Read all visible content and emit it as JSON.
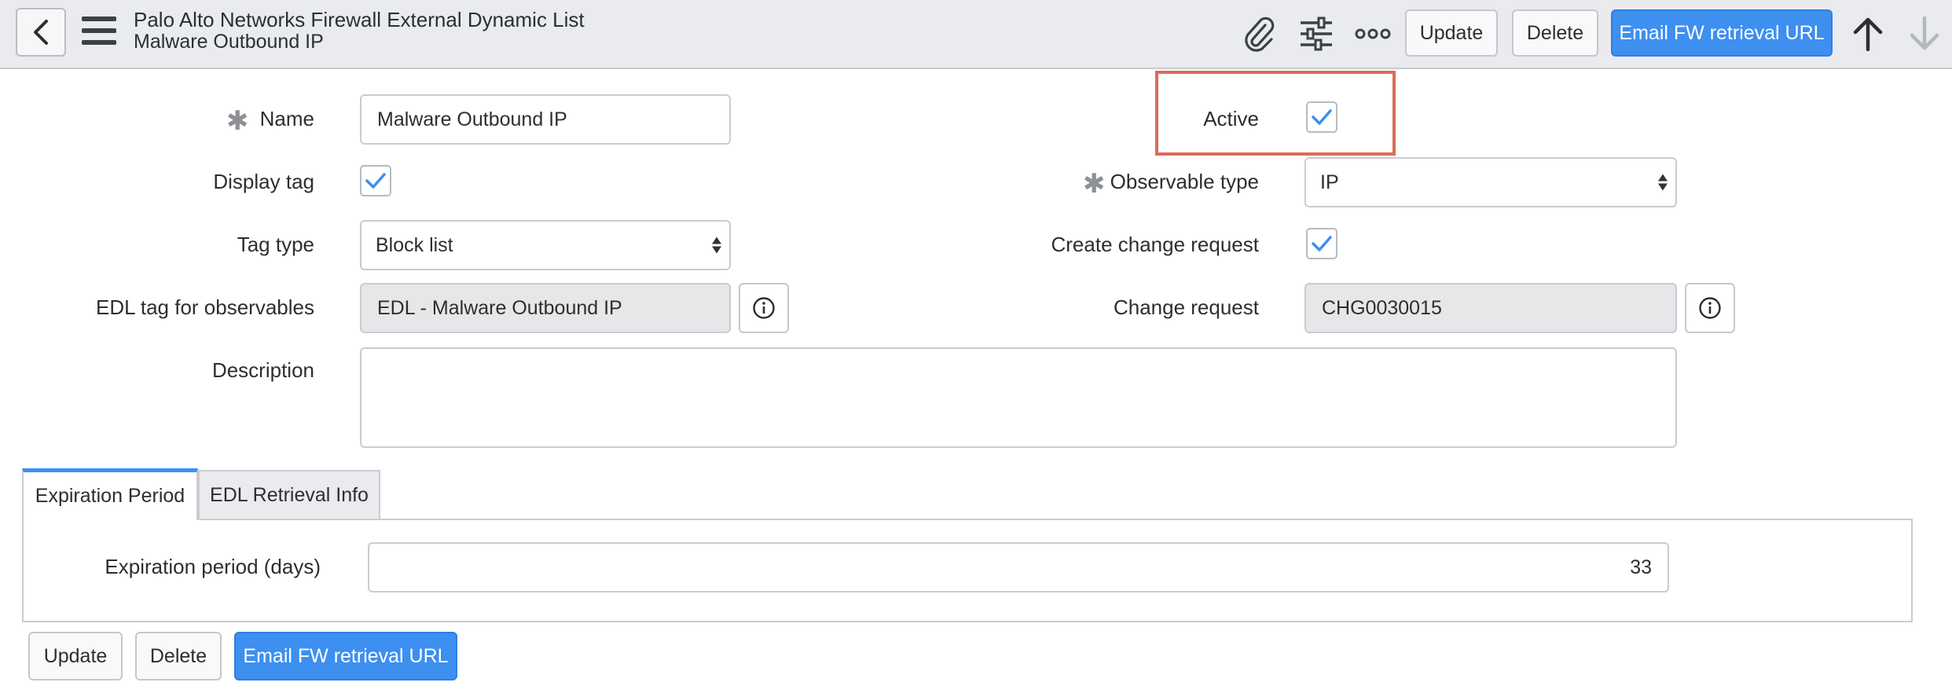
{
  "header": {
    "title": "Palo Alto Networks Firewall External Dynamic List",
    "subtitle": "Malware Outbound IP",
    "buttons": {
      "update": "Update",
      "delete": "Delete",
      "email": "Email FW retrieval URL"
    },
    "icons": [
      "back-chevron-icon",
      "hamburger-menu-icon",
      "paperclip-icon",
      "sliders-icon",
      "more-options-icon",
      "arrow-up-icon",
      "arrow-down-icon"
    ]
  },
  "form": {
    "name": {
      "label": "Name",
      "value": "Malware Outbound IP",
      "required": true
    },
    "active": {
      "label": "Active",
      "checked": true
    },
    "display_tag": {
      "label": "Display tag",
      "checked": true
    },
    "observable_type": {
      "label": "Observable type",
      "value": "IP",
      "required": true
    },
    "tag_type": {
      "label": "Tag type",
      "value": "Block list"
    },
    "create_change_request": {
      "label": "Create change request",
      "checked": true
    },
    "edl_tag": {
      "label": "EDL tag for observables",
      "value": "EDL - Malware Outbound IP"
    },
    "change_request": {
      "label": "Change request",
      "value": "CHG0030015"
    },
    "description": {
      "label": "Description",
      "value": ""
    }
  },
  "tabs": [
    {
      "label": "Expiration Period",
      "active": true
    },
    {
      "label": "EDL Retrieval Info",
      "active": false
    }
  ],
  "expiration": {
    "label": "Expiration period (days)",
    "value": "33"
  },
  "footer": {
    "update": "Update",
    "delete": "Delete",
    "email": "Email FW retrieval URL"
  },
  "colors": {
    "primary": "#3d8ff0",
    "header_bg": "#e9ebee",
    "highlight": "#dc6b58",
    "check": "#3d8ff0"
  }
}
